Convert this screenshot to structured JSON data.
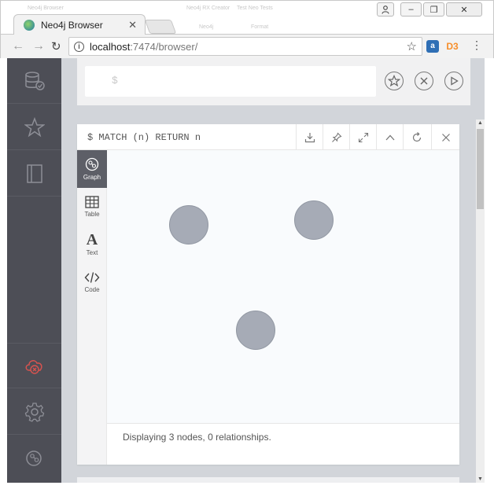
{
  "browser": {
    "tab_title": "Neo4j Browser",
    "tab_close": "✕",
    "background_tabs": [
      "Neo4j Browser",
      "Neo4j RX Creator",
      "Test Neo Tests",
      "Neo4j",
      "Format"
    ],
    "url_host": "localhost",
    "url_path": ":7474/browser/",
    "window_buttons": [
      "–",
      "❐",
      "✕"
    ],
    "extensions": [
      {
        "name": "extension-icon",
        "color": "#2f6fb5"
      },
      {
        "name": "d3-icon",
        "text": "D3",
        "color": "#f68e2a"
      }
    ]
  },
  "sidebar": {
    "items": [
      {
        "name": "database-icon"
      },
      {
        "name": "favorites-star-icon"
      },
      {
        "name": "documents-book-icon"
      },
      {
        "name": "disconnected-cloud-icon",
        "color": "#d9534f"
      },
      {
        "name": "settings-gear-icon"
      },
      {
        "name": "about-neo4j-icon"
      }
    ]
  },
  "editor": {
    "prompt": "$",
    "buttons": [
      {
        "name": "favorite-button"
      },
      {
        "name": "clear-button"
      },
      {
        "name": "run-button"
      }
    ]
  },
  "frame": {
    "query": "$ MATCH (n) RETURN n",
    "header_buttons": [
      "download",
      "pin",
      "fullscreen",
      "collapse",
      "rerun",
      "close"
    ],
    "views": [
      {
        "label": "Graph",
        "active": true
      },
      {
        "label": "Table",
        "active": false
      },
      {
        "label": "Text",
        "active": false
      },
      {
        "label": "Code",
        "active": false
      }
    ],
    "nodes_count": 3,
    "status_text": "Displaying 3 nodes, 0 relationships."
  },
  "colors": {
    "sidebar": "#4d4e56",
    "main_bg": "#d2d5da",
    "node_fill": "#a6abb6",
    "active_view": "#5d5f67"
  }
}
